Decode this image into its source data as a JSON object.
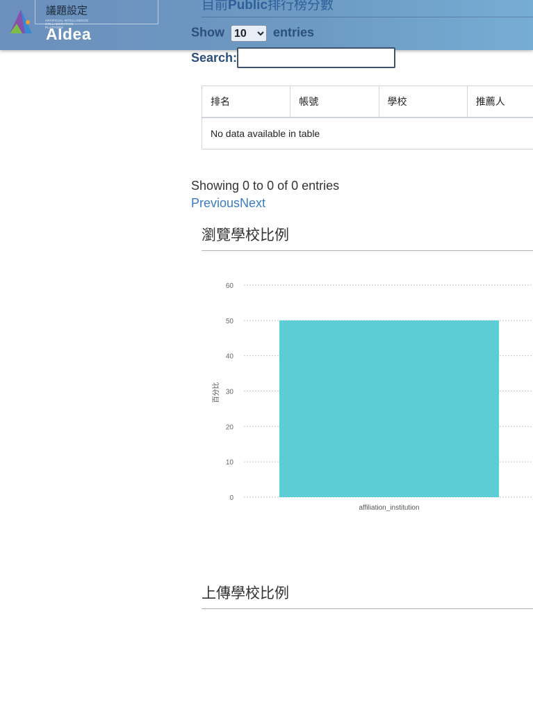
{
  "header": {
    "logo_tagline": [
      "ARTIFICIAL INTELLIGENCE",
      "COLLABORATION PLATFORM"
    ],
    "logo_text": "AIdea",
    "sidebar_item": "議題設定",
    "heading_prefix": "目前",
    "heading_bold": "Public",
    "heading_suffix": "排行榜分數"
  },
  "datatable": {
    "show_label": "Show",
    "entries_label": "entries",
    "page_size": "10",
    "page_size_options": [
      "10"
    ],
    "search_label": "Search:",
    "search_value": "",
    "columns": [
      "排名",
      "帳號",
      "學校",
      "推薦人"
    ],
    "empty_message": "No data available in table",
    "info": "Showing 0 to 0 of 0 entries",
    "previous": "Previous",
    "next": "Next"
  },
  "sections": {
    "browse_title": "瀏覽學校比例",
    "upload_title": "上傳學校比例"
  },
  "chart_data": {
    "type": "bar",
    "title": "",
    "categories": [
      "affiliation_institution"
    ],
    "values": [
      50
    ],
    "ylabel": "百分比",
    "xlabel": "",
    "ylim": [
      0,
      60
    ],
    "yticks": [
      0,
      10,
      20,
      30,
      40,
      50,
      60
    ],
    "grid": true,
    "bar_color": "#5ccdd4"
  }
}
